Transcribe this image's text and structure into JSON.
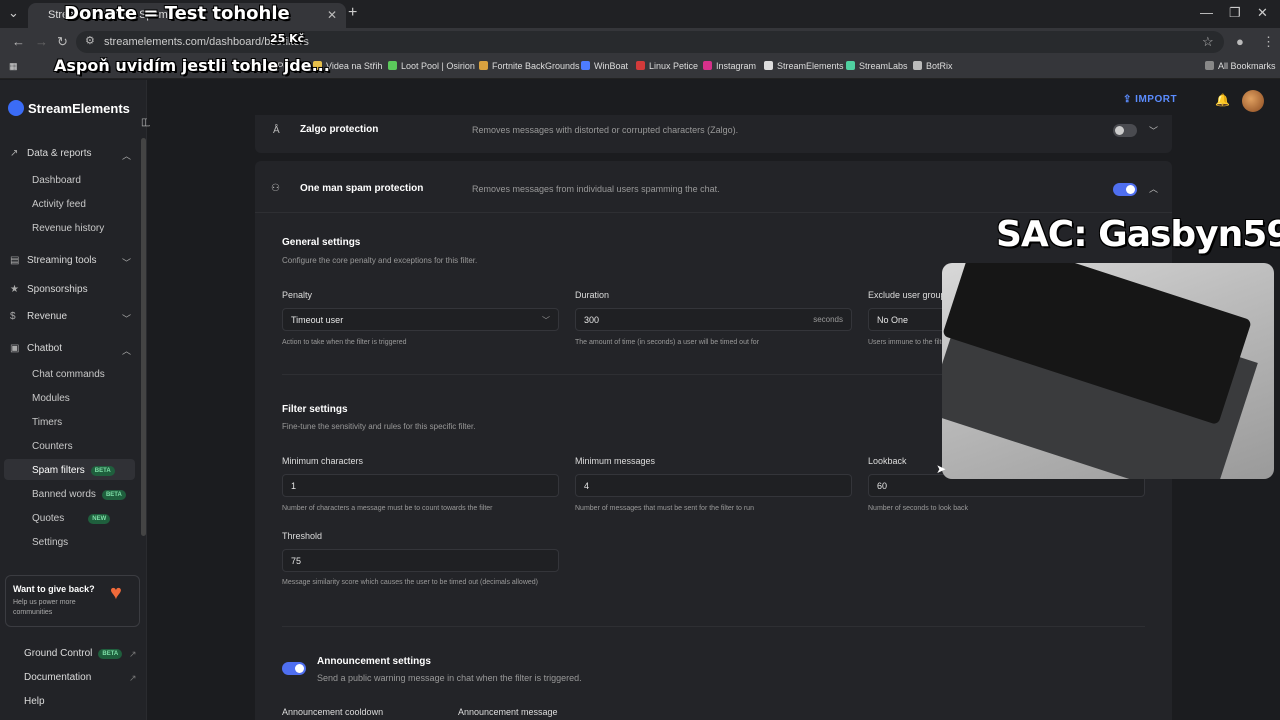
{
  "browser": {
    "tab_title": "StreamElements - Spam filters",
    "url": "streamelements.com/dashboard/bot/filters",
    "bookmarks": [
      "Creator Portal",
      "Videa na Střih",
      "Loot Pool | Osirion",
      "Fortnite BackGrounds",
      "WinBoat",
      "Linux Petice",
      "Instagram",
      "StreamElements",
      "StreamLabs",
      "BotRix"
    ],
    "all_bookmarks": "All Bookmarks"
  },
  "overlay": {
    "donate": "Donate = Test tohohle",
    "amount": "25 Kč",
    "message": "Aspoň uvidím jestli tohle jde...",
    "sac": "SAC: Gasbyn59"
  },
  "sidebar": {
    "brand": "StreamElements",
    "sections": [
      {
        "label": "Data & reports",
        "items": [
          "Dashboard",
          "Activity feed",
          "Revenue history"
        ]
      },
      {
        "label": "Streaming tools"
      },
      {
        "label": "Sponsorships"
      },
      {
        "label": "Revenue"
      },
      {
        "label": "Chatbot",
        "items": [
          "Chat commands",
          "Modules",
          "Timers",
          "Counters",
          "Spam filters",
          "Banned words",
          "Quotes",
          "Settings"
        ]
      }
    ],
    "badges": {
      "spam_filters": "BETA",
      "banned_words": "BETA",
      "quotes": "NEW",
      "ground_control": "BETA"
    },
    "give_back": {
      "title": "Want to give back?",
      "subtitle": "Help us power more communities"
    },
    "footer": [
      "Ground Control",
      "Documentation",
      "Help"
    ]
  },
  "topbar": {
    "import": "IMPORT"
  },
  "filters": {
    "zalgo": {
      "title": "Zalgo protection",
      "desc": "Removes messages with distorted or corrupted characters (Zalgo).",
      "enabled": false
    },
    "one_man": {
      "title": "One man spam protection",
      "desc": "Removes messages from individual users spamming the chat.",
      "enabled": true
    }
  },
  "general": {
    "title": "General settings",
    "subtitle": "Configure the core penalty and exceptions for this filter.",
    "penalty_label": "Penalty",
    "penalty_value": "Timeout user",
    "penalty_help": "Action to take when the filter is triggered",
    "duration_label": "Duration",
    "duration_value": "300",
    "duration_suffix": "seconds",
    "duration_help": "The amount of time (in seconds) a user will be timed out for",
    "exclude_label": "Exclude user groups",
    "exclude_value": "No One",
    "exclude_help": "Users immune to the filter"
  },
  "filter_settings": {
    "title": "Filter settings",
    "subtitle": "Fine-tune the sensitivity and rules for this specific filter.",
    "min_chars_label": "Minimum characters",
    "min_chars_value": "1",
    "min_chars_help": "Number of characters a message must be to count towards the filter",
    "min_msgs_label": "Minimum messages",
    "min_msgs_value": "4",
    "min_msgs_help": "Number of messages that must be sent for the filter to run",
    "lookback_label": "Lookback",
    "lookback_value": "60",
    "lookback_help": "Number of seconds to look back",
    "threshold_label": "Threshold",
    "threshold_value": "75",
    "threshold_help": "Message similarity score which causes the user to be timed out (decimals allowed)"
  },
  "announcement": {
    "title": "Announcement settings",
    "subtitle": "Send a public warning message in chat when the filter is triggered.",
    "enabled": true,
    "cooldown_label": "Announcement cooldown",
    "message_label": "Announcement message"
  }
}
